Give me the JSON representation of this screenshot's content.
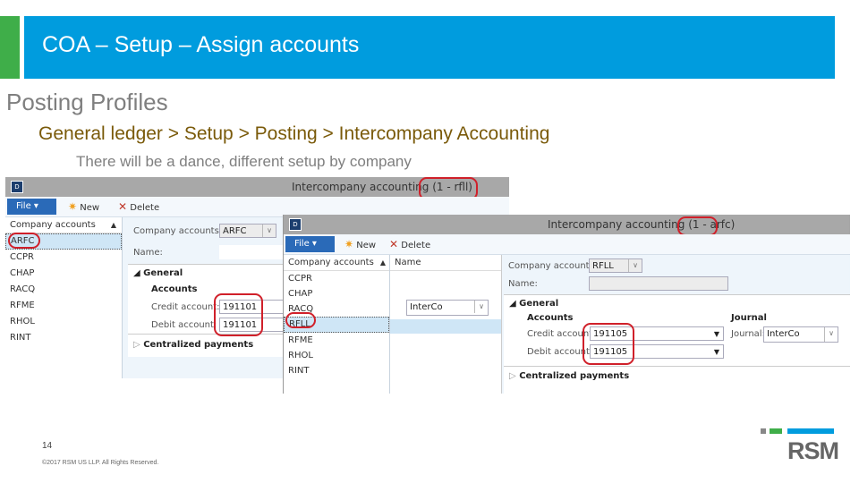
{
  "slide": {
    "title": "COA – Setup – Assign accounts",
    "heading": "Posting Profiles",
    "path": "General ledger > Setup > Posting > Intercompany Accounting",
    "note": "There will be a dance, different setup by company",
    "page_number": "14",
    "copyright": "©2017 RSM US LLP. All Rights Reserved.",
    "logo_text": "RSM",
    "colors": {
      "accent_blue": "#009cde",
      "accent_green": "#3fae49",
      "path_text": "#7a5a0a",
      "highlight_red": "#d0202a"
    }
  },
  "window1": {
    "title": "Intercompany accounting (1 - rfll)",
    "ribbon": {
      "file": "File",
      "new": "New",
      "delete": "Delete"
    },
    "list_header": "Company accounts",
    "list_items": [
      "ARFC",
      "CCPR",
      "CHAP",
      "RACQ",
      "RFME",
      "RHOL",
      "RINT"
    ],
    "selected": "ARFC",
    "company_accounts_label": "Company accounts:",
    "company_accounts_value": "ARFC",
    "name_label": "Name:",
    "section_general": "General",
    "accounts_label": "Accounts",
    "credit_label": "Credit account:",
    "credit_value": "191101",
    "debit_label": "Debit account:",
    "debit_value": "191101",
    "section_payments": "Centralized payments"
  },
  "window2": {
    "title": "Intercompany accounting (1 - arfc)",
    "ribbon": {
      "file": "File",
      "new": "New",
      "delete": "Delete"
    },
    "list_header": "Company accounts",
    "name_header": "Name",
    "list_items": [
      "CCPR",
      "CHAP",
      "RACQ",
      "RFLL",
      "RFME",
      "RHOL",
      "RINT"
    ],
    "selected": "RFLL",
    "overlay_journal_value": "InterCo",
    "company_accounts_label": "Company accounts:",
    "company_accounts_value": "RFLL",
    "name_label": "Name:",
    "section_general": "General",
    "accounts_label": "Accounts",
    "credit_label": "Credit account:",
    "credit_value": "191105",
    "debit_label": "Debit account:",
    "debit_value": "191105",
    "journal_header": "Journal",
    "journal_label": "Journal:",
    "journal_value": "InterCo",
    "section_payments": "Centralized payments"
  }
}
